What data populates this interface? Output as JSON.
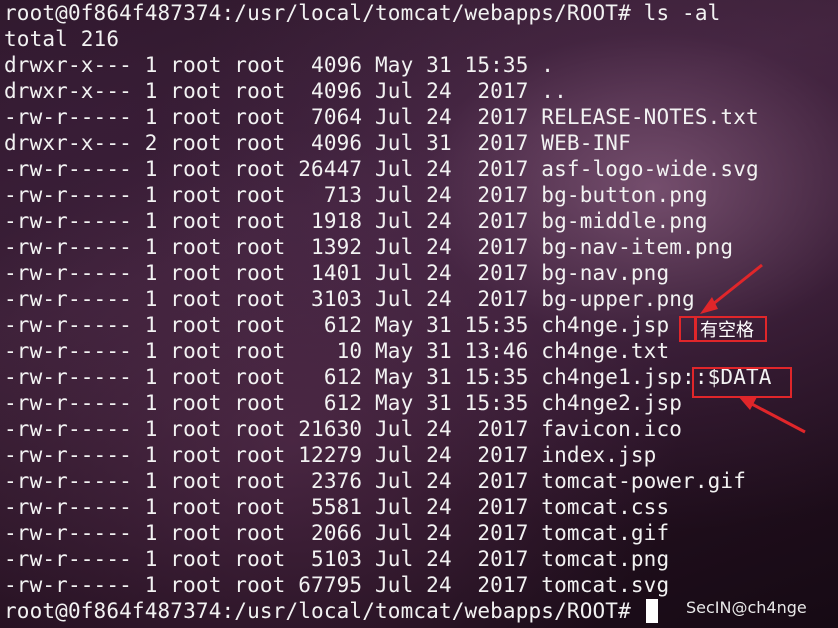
{
  "terminal": {
    "prompt": "root@0f864f487374:/usr/local/tomcat/webapps/ROOT# ls -al",
    "total": "total 216",
    "entries": [
      "drwxr-x--- 1 root root  4096 May 31 15:35 .",
      "drwxr-x--- 1 root root  4096 Jul 24  2017 ..",
      "-rw-r----- 1 root root  7064 Jul 24  2017 RELEASE-NOTES.txt",
      "drwxr-x--- 2 root root  4096 Jul 31  2017 WEB-INF",
      "-rw-r----- 1 root root 26447 Jul 24  2017 asf-logo-wide.svg",
      "-rw-r----- 1 root root   713 Jul 24  2017 bg-button.png",
      "-rw-r----- 1 root root  1918 Jul 24  2017 bg-middle.png",
      "-rw-r----- 1 root root  1392 Jul 24  2017 bg-nav-item.png",
      "-rw-r----- 1 root root  1401 Jul 24  2017 bg-nav.png",
      "-rw-r----- 1 root root  3103 Jul 24  2017 bg-upper.png",
      "-rw-r----- 1 root root   612 May 31 15:35 ch4nge.jsp ",
      "-rw-r----- 1 root root    10 May 31 13:46 ch4nge.txt",
      "-rw-r----- 1 root root   612 May 31 15:35 ch4nge1.jsp::$DATA",
      "-rw-r----- 1 root root   612 May 31 15:35 ch4nge2.jsp",
      "-rw-r----- 1 root root 21630 Jul 24  2017 favicon.ico",
      "-rw-r----- 1 root root 12279 Jul 24  2017 index.jsp",
      "-rw-r----- 1 root root  2376 Jul 24  2017 tomcat-power.gif",
      "-rw-r----- 1 root root  5581 Jul 24  2017 tomcat.css",
      "-rw-r----- 1 root root  2066 Jul 24  2017 tomcat.gif",
      "-rw-r----- 1 root root  5103 Jul 24  2017 tomcat.png",
      "-rw-r----- 1 root root 67795 Jul 24  2017 tomcat.svg"
    ],
    "final_prompt": "root@0f864f487374:/usr/local/tomcat/webapps/ROOT# "
  },
  "annotations": {
    "space_note": "有空格",
    "color": "#e0262a"
  },
  "watermark": "SecIN@ch4nge"
}
